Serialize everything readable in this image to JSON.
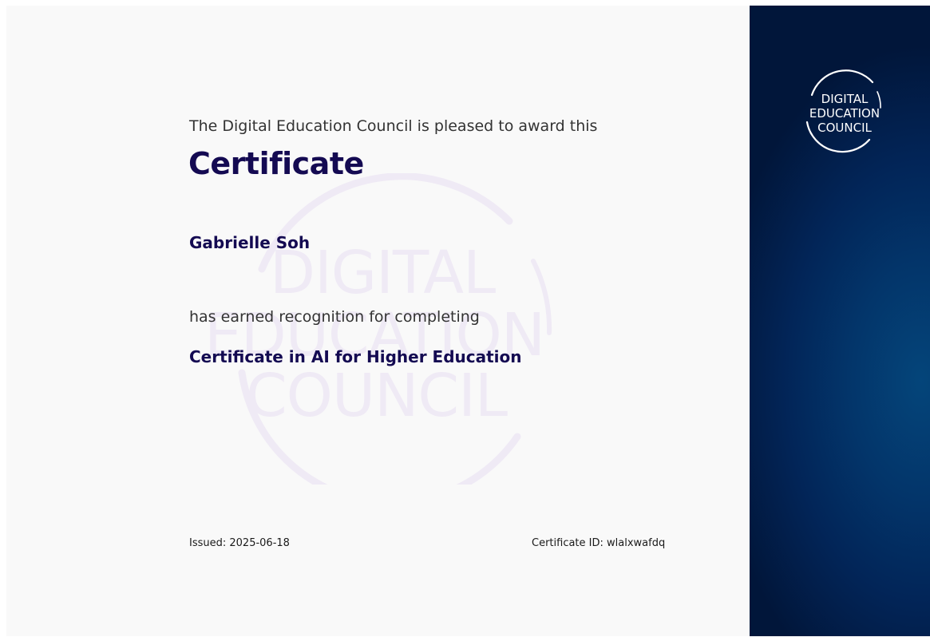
{
  "certificate": {
    "intro": "The Digital Education Council is pleased to award this",
    "title": "Certificate",
    "recipient_name": "Gabrielle Soh",
    "earned_text": "has earned recognition for completing",
    "course_name": "Certificate in AI for Higher Education",
    "issued": "Issued: 2025-06-18",
    "certificate_id": "Certificate ID: wlalxwafdq"
  },
  "logo": {
    "lines": [
      "DIGITAL",
      "EDUCATION",
      "COUNCIL"
    ]
  },
  "colors": {
    "title_navy": "#140a52",
    "body_text": "#333333",
    "background": "#f9f9f9",
    "side_panel_dark": "#01163a",
    "side_panel_glow": "#04457a",
    "watermark": "#efeaf5"
  }
}
